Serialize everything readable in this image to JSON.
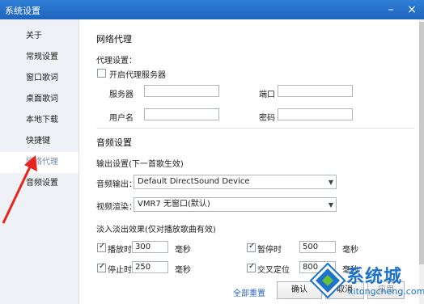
{
  "window": {
    "title": "系统设置",
    "minimize_icon": "minimize-icon",
    "close_icon": "close-icon"
  },
  "sidebar": {
    "items": [
      {
        "label": "关于"
      },
      {
        "label": "常规设置"
      },
      {
        "label": "窗口歌词"
      },
      {
        "label": "桌面歌词"
      },
      {
        "label": "本地下载"
      },
      {
        "label": "快捷键"
      },
      {
        "label": "网络代理",
        "active": true
      },
      {
        "label": "音频设置"
      }
    ]
  },
  "proxy": {
    "section_title": "网络代理",
    "settings_label": "代理设置：",
    "enable_checkbox": {
      "label": "开启代理服务器",
      "checked": false
    },
    "server_label": "服务器",
    "server_value": "",
    "port_label": "端口",
    "port_value": "",
    "username_label": "用户名",
    "username_value": "",
    "password_label": "密码",
    "password_value": ""
  },
  "audio": {
    "section_title": "音频设置",
    "output_group_label": "输出设置(下一首歌生效)",
    "audio_output_label": "音频输出：",
    "audio_output_value": "Default DirectSound Device",
    "video_render_label": "视频渲染：",
    "video_render_value": "VMR7 无窗口(默认)",
    "fade_label": "淡入淡出效果(仅对播放歌曲有效)",
    "play_time": {
      "label": "播放时",
      "value": "300",
      "unit": "毫秒",
      "checked": true
    },
    "pause_time": {
      "label": "暂停时",
      "value": "500",
      "unit": "毫秒",
      "checked": true
    },
    "stop_time": {
      "label": "停止时",
      "value": "250",
      "unit": "毫秒",
      "checked": true
    },
    "seek_time": {
      "label": "交叉定位",
      "value": "800",
      "unit": "毫秒",
      "checked": true
    }
  },
  "footer": {
    "reset_link": "全部重置",
    "ok_button": "确认",
    "cancel_button": "取消",
    "apply_button": "应用"
  },
  "watermark": {
    "text": "系统城",
    "url_text": "xitongcheng.com"
  },
  "colors": {
    "titlebar": "#1f64bd",
    "link": "#2a64c7",
    "annotation": "#e8241f"
  }
}
